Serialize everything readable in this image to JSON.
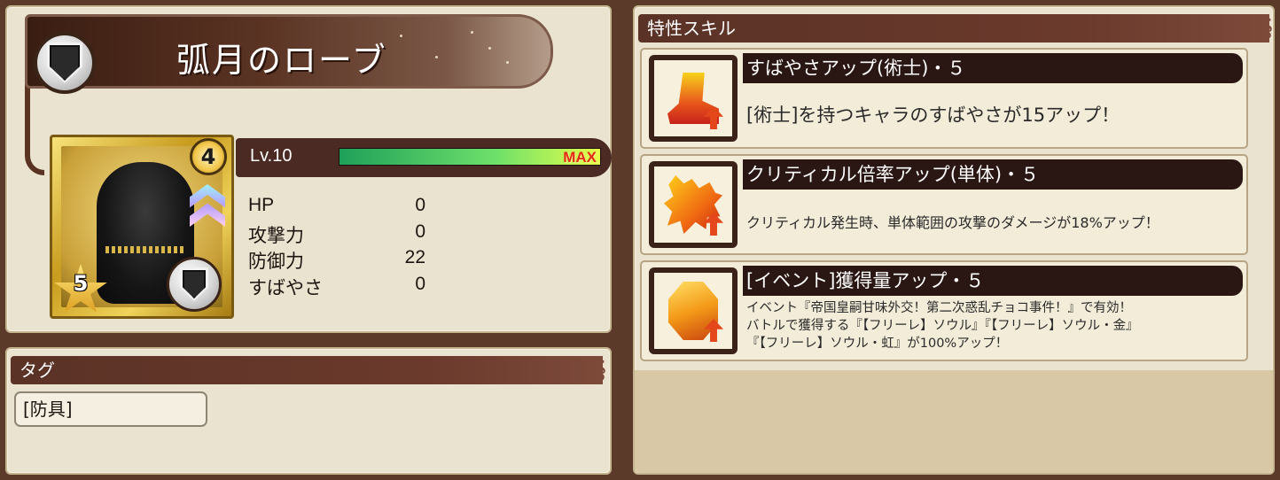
{
  "item": {
    "name": "弧月のローブ",
    "type_icon": "shield-icon",
    "rarity_level": "4",
    "stars": "5"
  },
  "level": {
    "label": "Lv.10",
    "max_label": "MAX",
    "progress": 1.0
  },
  "stats": [
    {
      "name": "HP",
      "value": "0"
    },
    {
      "name": "攻撃力",
      "value": "0"
    },
    {
      "name": "防御力",
      "value": "22"
    },
    {
      "name": "すばやさ",
      "value": "0"
    }
  ],
  "tags": {
    "header": "タグ",
    "items": [
      "[防具]"
    ]
  },
  "skills": {
    "header": "特性スキル",
    "items": [
      {
        "icon": "boot-icon",
        "title": "すばやさアップ(術士)・５",
        "desc_lines": [
          "[術士]を持つキャラのすばやさが15アップ！"
        ]
      },
      {
        "icon": "sword-icon",
        "title": "クリティカル倍率アップ(単体)・５",
        "desc_lines": [
          "クリティカル発生時、単体範囲の攻撃のダメージが18%アップ！"
        ]
      },
      {
        "icon": "gem-icon",
        "title": "[イベント]獲得量アップ・５",
        "desc_lines": [
          "イベント『帝国皇嗣甘味外交！第二次惑乱チョコ事件！』で有効！",
          "バトルで獲得する『【フリーレ】ソウル』『【フリーレ】ソウル・金』",
          "『【フリーレ】ソウル・虹』が100%アップ！"
        ]
      }
    ]
  },
  "colors": {
    "background": "#5b3a2a",
    "panel": "#eae3cf",
    "header": "#5a3226",
    "max_text": "#e22b14"
  }
}
